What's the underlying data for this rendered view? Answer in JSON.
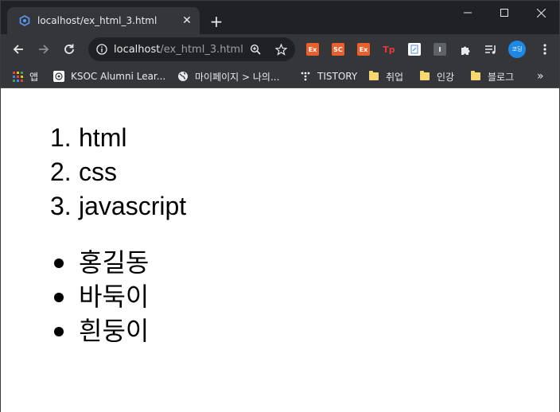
{
  "tab": {
    "title": "localhost/ex_html_3.html",
    "close": "✕"
  },
  "new_tab": "+",
  "window_controls": {
    "minimize": "─",
    "maximize": "☐",
    "close": "✕"
  },
  "omnibox": {
    "host": "localhost",
    "path": "/ex_html_3.html"
  },
  "extensions": [
    {
      "name": "ext-ex-icon",
      "label": "Ex",
      "color": "#e8612c"
    },
    {
      "name": "ext-sc-icon",
      "label": "SC",
      "color": "#e8612c"
    },
    {
      "name": "ext-ex2-icon",
      "label": "Ex",
      "color": "#e8612c"
    },
    {
      "name": "ext-tp-icon",
      "label": "Tp",
      "color": "#e53935"
    },
    {
      "name": "ext-doc-icon",
      "label": "",
      "color": "#ffffff"
    },
    {
      "name": "ext-i-icon",
      "label": "I",
      "color": "#5f6368"
    }
  ],
  "profile_label": "코딩",
  "bookmarks": {
    "apps": "앱",
    "ksoc": "KSOC Alumni Lear...",
    "mypage": "마이페이지 > 나의...",
    "tistory": "TISTORY",
    "job": "취업",
    "lecture": "인강",
    "blog": "블로그",
    "more": "»"
  },
  "ordered_list": [
    {
      "num": "1.",
      "text": "html"
    },
    {
      "num": "2.",
      "text": "css"
    },
    {
      "num": "3.",
      "text": "javascript"
    }
  ],
  "unordered_list": [
    {
      "text": "홍길동"
    },
    {
      "text": "바둑이"
    },
    {
      "text": "흰둥이"
    }
  ]
}
